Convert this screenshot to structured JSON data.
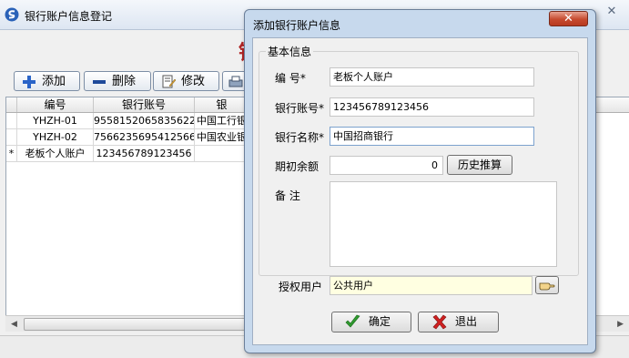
{
  "main_window": {
    "title": "银行账户信息登记",
    "big_title_partial": "银",
    "toolbar": {
      "add_label": "添加",
      "delete_label": "删除",
      "edit_label": "修改"
    },
    "grid": {
      "columns": [
        "编号",
        "银行账号",
        "银"
      ],
      "rows": [
        {
          "indicator": "",
          "id": "YHZH-01",
          "account": "95581520658356221",
          "bank": "中国工行银"
        },
        {
          "indicator": "",
          "id": "YHZH-02",
          "account": "75662356954125665",
          "bank": "中国农业银"
        },
        {
          "indicator": "*",
          "id": "老板个人账户",
          "account": "123456789123456",
          "bank": ""
        }
      ]
    }
  },
  "dialog": {
    "title": "添加银行账户信息",
    "close_glyph": "✕",
    "group_title": "基本信息",
    "fields": {
      "code_label": "编    号",
      "code_value": "老板个人账户",
      "account_label": "银行账号",
      "account_value": "123456789123456",
      "bank_label": "银行名称",
      "bank_value": "中国招商银行",
      "balance_label": "期初余额",
      "balance_value": "0",
      "history_button": "历史推算",
      "remark_label": "备    注",
      "remark_value": "",
      "auth_label": "授权用户",
      "auth_value": "公共用户"
    },
    "required_mark": "*",
    "ok_label": "确定",
    "exit_label": "退出"
  },
  "icons": {
    "app": "s-logo-icon",
    "add": "plus-icon",
    "delete": "minus-icon",
    "edit": "edit-document-icon",
    "print": "printer-icon",
    "lookup": "hand-pointer-icon",
    "ok": "check-icon",
    "exit": "x-icon"
  },
  "colors": {
    "big_title": "#b02424",
    "dialog_frame": "#c7d9ed",
    "close_button": "#c64a2e",
    "auth_field_bg": "#ffffe1"
  }
}
